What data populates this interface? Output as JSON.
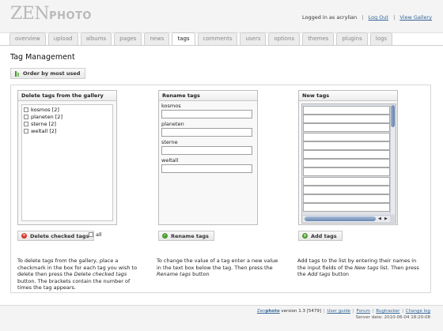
{
  "header": {
    "logo": {
      "zen": "ZEN",
      "photo": "PHOTO"
    },
    "user": {
      "logged_in": "Logged in as acrylian",
      "logout": "Log Out",
      "view_gallery": "View Gallery"
    }
  },
  "tabs": [
    {
      "label": "overview",
      "active": false
    },
    {
      "label": "upload",
      "active": false
    },
    {
      "label": "albums",
      "active": false
    },
    {
      "label": "pages",
      "active": false
    },
    {
      "label": "news",
      "active": false
    },
    {
      "label": "tags",
      "active": true
    },
    {
      "label": "comments",
      "active": false
    },
    {
      "label": "users",
      "active": false
    },
    {
      "label": "options",
      "active": false
    },
    {
      "label": "themes",
      "active": false
    },
    {
      "label": "plugins",
      "active": false
    },
    {
      "label": "logs",
      "active": false
    }
  ],
  "page": {
    "title": "Tag Management",
    "order_button": "Order by most used"
  },
  "delete_panel": {
    "title": "Delete tags from the gallery",
    "tags": [
      "kosmos [2]",
      "planeten [2]",
      "sterne [2]",
      "weltall [2]"
    ],
    "button": "Delete checked tags",
    "all_label": "all",
    "help_parts": {
      "a": "To delete tags from the gallery, place a checkmark in the box for each tag you wish to delete then press the ",
      "b": "Delete checked tags",
      "c": " button. The brackets contain the number of times the tag appears."
    }
  },
  "rename_panel": {
    "title": "Rename tags",
    "tags": [
      "kosmos",
      "planeten",
      "sterne",
      "weltall"
    ],
    "button": "Rename tags",
    "help_parts": {
      "a": "To change the value of a tag enter a new value in the text box below the tag. Then press the ",
      "b": "Rename tags",
      "c": " button"
    }
  },
  "new_panel": {
    "title": "New tags",
    "input_count": 12,
    "button": "Add tags",
    "help_parts": {
      "a": "Add tags to the list by entering their names in the input fields of the ",
      "b": "New tags",
      "c": " list. Then press the ",
      "d": "Add tags",
      "e": " button"
    }
  },
  "footer": {
    "brand_zen": "Zen",
    "brand_photo": "photo",
    "version": "version 1.3 [5479]",
    "links": [
      "User guide",
      "Forum",
      "Bugtracker",
      "Change log"
    ],
    "server_date": "Server date: 2010-06-04 18:20:08"
  },
  "colors": {
    "link": "#336699",
    "delete_icon": "#d8392b",
    "ok_icon": "#4d9c2f",
    "scrollbar_thumb": "#5d7eab"
  },
  "icons": {
    "order": "bars-icon",
    "delete": "delete-icon",
    "rename": "checkmark-icon",
    "add": "add-icon"
  }
}
